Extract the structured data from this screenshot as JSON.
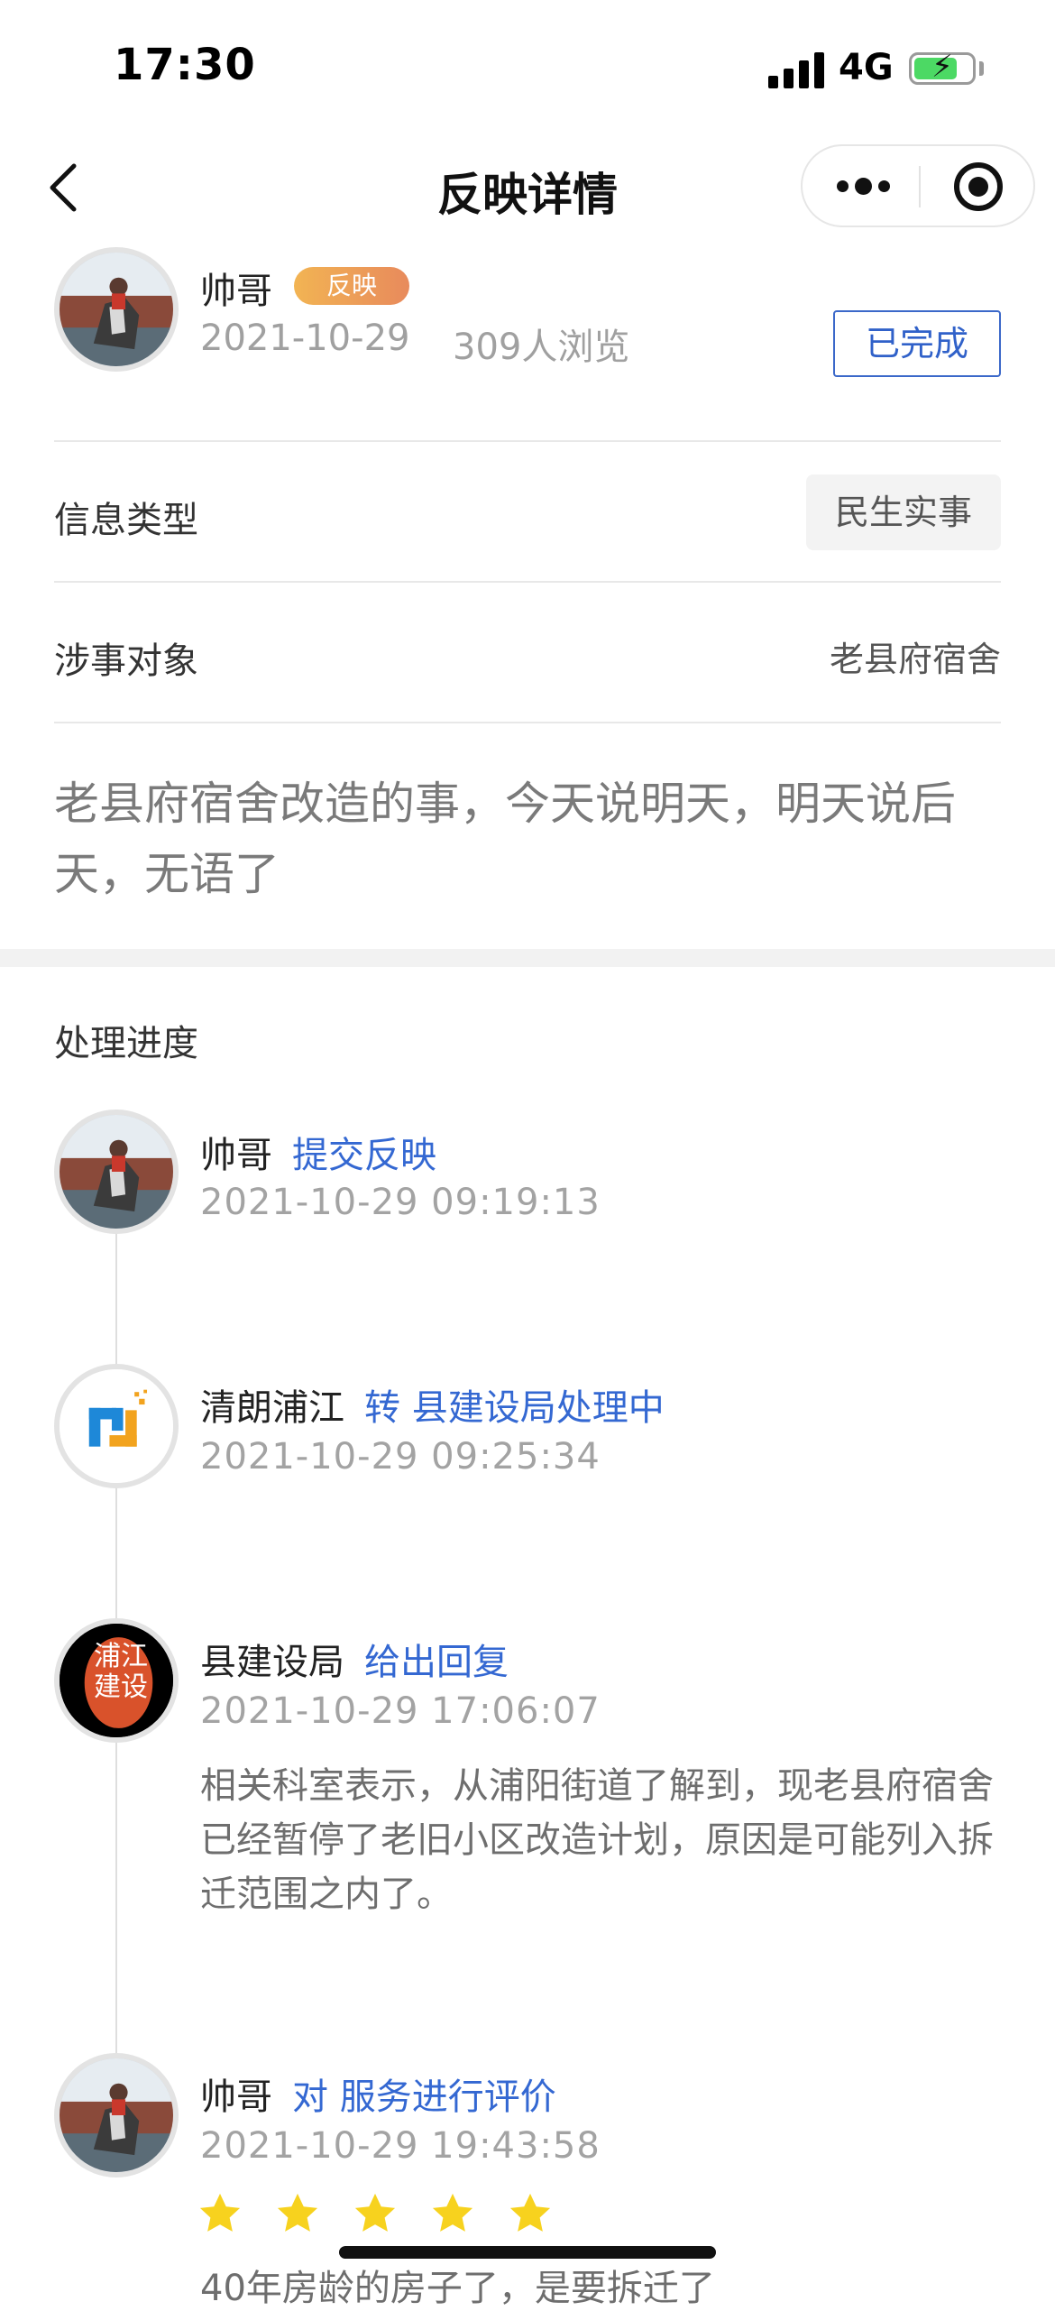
{
  "status_bar": {
    "time": "17:30",
    "network": "4G",
    "battery_level": 0.75
  },
  "nav": {
    "title": "反映详情"
  },
  "post": {
    "author": "帅哥",
    "tag": "反映",
    "date": "2021-10-29",
    "views": "309人浏览",
    "status_button": "已完成",
    "info_type_label": "信息类型",
    "info_type_value": "民生实事",
    "subject_label": "涉事对象",
    "subject_value": "老县府宿舍",
    "content": "老县府宿舍改造的事，今天说明天，明天说后天，无语了"
  },
  "progress": {
    "title": "处理进度",
    "steps": [
      {
        "name": "帅哥",
        "action": "提交反映",
        "time": "2021-10-29 09:19:13"
      },
      {
        "name": "清朗浦江",
        "action": "转 县建设局处理中",
        "time": "2021-10-29 09:25:34"
      },
      {
        "name": "县建设局",
        "action": "给出回复",
        "time": "2021-10-29 17:06:07",
        "text": "相关科室表示，从浦阳街道了解到，现老县府宿舍已经暂停了老旧小区改造计划，原因是可能列入拆迁范围之内了。",
        "seal_text": "浦江建设"
      },
      {
        "name": "帅哥",
        "action": "对 服务进行评价",
        "time": "2021-10-29 19:43:58",
        "rating": 5,
        "text": "40年房龄的房子了，是要拆迁了"
      }
    ]
  },
  "colors": {
    "accent": "#3468d2",
    "star": "#f7d21e",
    "tag_start": "#f2b453",
    "tag_end": "#e88a5c"
  }
}
